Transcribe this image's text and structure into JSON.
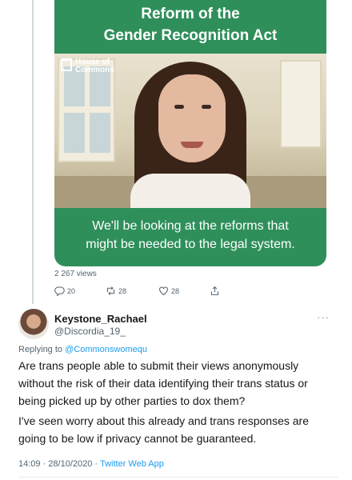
{
  "quoted_media": {
    "title_line1": "Reform of the",
    "title_line2": "Gender Recognition Act",
    "logo_line1": "House of",
    "logo_line2": "Commons",
    "caption_line1": "We'll be looking at the reforms that",
    "caption_line2": "might be needed to the legal system.",
    "brand_color": "#2f8f5b"
  },
  "parent_tweet": {
    "views": "2 267 views",
    "reply_count": "20",
    "retweet_count": "28",
    "like_count": "28"
  },
  "tweet": {
    "display_name": "Keystone_Rachael",
    "handle": "@Discordia_19_",
    "more_icon": "ellipsis-icon",
    "replying_prefix": "Replying to ",
    "replying_to": "@Commonswomequ",
    "text_p1_line1": "Are trans people able to submit their views anonymously",
    "text_p1_line2": "without the risk of their data identifying their trans status or",
    "text_p1_line3": "being picked up by other parties to dox them?",
    "text_p2_line1": "I've seen worry about this already and trans responses are",
    "text_p2_line2": "going to be low if privacy cannot be guaranteed.",
    "timestamp": "14:09 · 28/10/2020 · ",
    "source_app": "Twitter Web App",
    "link_color": "#1d9bf0"
  }
}
